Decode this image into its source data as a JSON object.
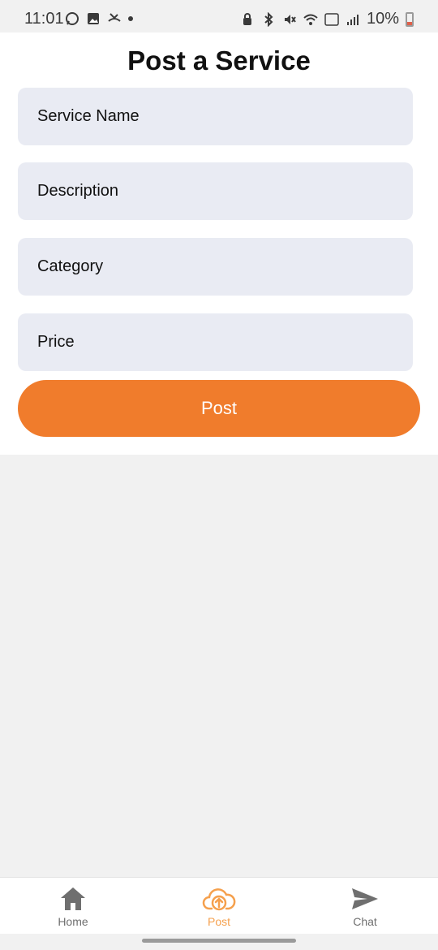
{
  "status_bar": {
    "time": "11:01",
    "battery": "10%",
    "left_icons": [
      "whatsapp-icon",
      "image-icon",
      "missed-call-icon",
      "notification-dot"
    ],
    "right_icons": [
      "lock-icon",
      "bluetooth-icon",
      "mute-icon",
      "wifi-icon",
      "volte-5g-icon",
      "signal-icon"
    ]
  },
  "page": {
    "title": "Post a Service"
  },
  "form": {
    "fields": [
      {
        "placeholder": "Service Name"
      },
      {
        "placeholder": "Description"
      },
      {
        "placeholder": "Category"
      },
      {
        "placeholder": "Price"
      }
    ],
    "submit_label": "Post"
  },
  "bottom_nav": {
    "items": [
      {
        "label": "Home",
        "icon": "home-icon",
        "active": false
      },
      {
        "label": "Post",
        "icon": "cloud-upload-icon",
        "active": true
      },
      {
        "label": "Chat",
        "icon": "send-icon",
        "active": false
      }
    ]
  },
  "colors": {
    "accent": "#f07c2c",
    "nav_active": "#f5a04d",
    "nav_inactive": "#6f6f6f",
    "field_bg": "#e9ebf3",
    "screen_bg": "#f1f1f1"
  }
}
